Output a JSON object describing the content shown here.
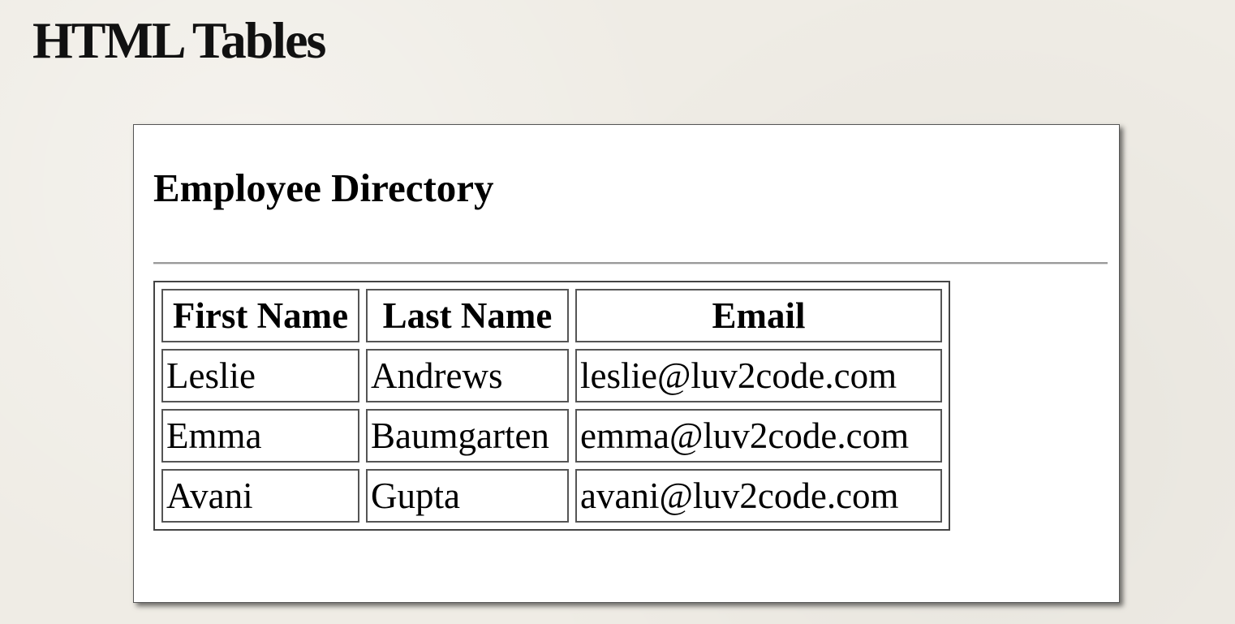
{
  "slide": {
    "title": "HTML Tables"
  },
  "page": {
    "heading": "Employee Directory"
  },
  "table": {
    "headers": [
      "First Name",
      "Last Name",
      "Email"
    ],
    "rows": [
      [
        "Leslie",
        "Andrews",
        "leslie@luv2code.com"
      ],
      [
        "Emma",
        "Baumgarten",
        "emma@luv2code.com"
      ],
      [
        "Avani",
        "Gupta",
        "avani@luv2code.com"
      ]
    ]
  }
}
